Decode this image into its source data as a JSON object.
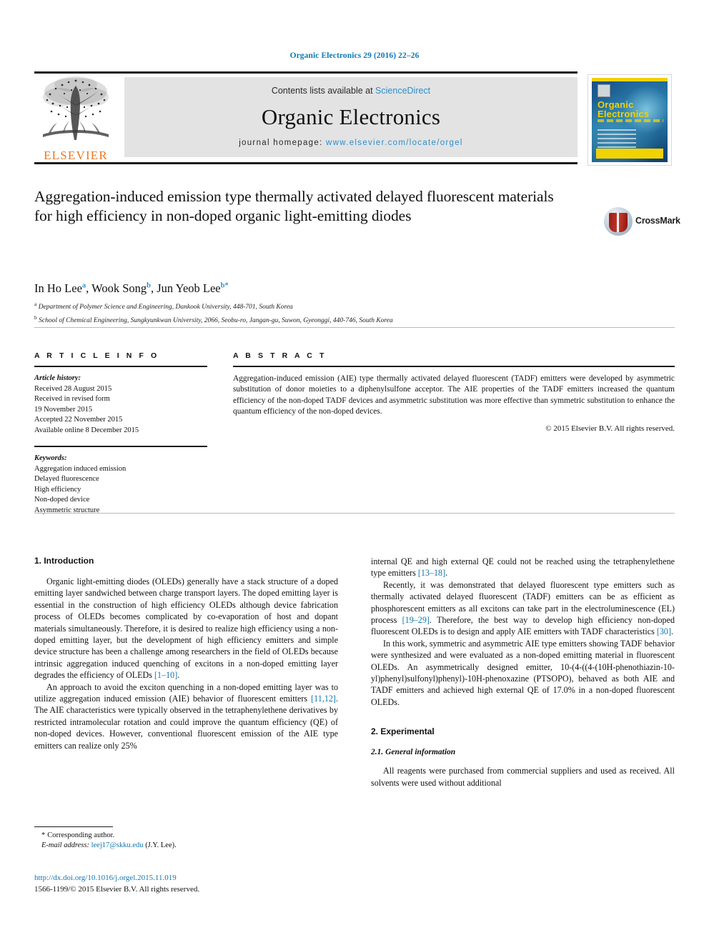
{
  "journal_ref": "Organic Electronics 29 (2016) 22–26",
  "masthead": {
    "contents_prefix": "Contents lists available at ",
    "sciencedirect": "ScienceDirect",
    "journal_name": "Organic Electronics",
    "homepage_prefix": "journal homepage: ",
    "homepage_url": "www.elsevier.com/locate/orgel",
    "publisher_wordmark": "ELSEVIER",
    "publisher_logo_icon": "elsevier-tree-icon",
    "accent_blue": "#2b8fd0",
    "publisher_orange": "#e87722"
  },
  "cover": {
    "line1": "Organic",
    "line2": "Electronics",
    "accent_yellow": "#f2d200"
  },
  "crossmark": {
    "label": "CrossMark",
    "logo_icon": "crossmark-logo-icon"
  },
  "article": {
    "title": "Aggregation-induced emission type thermally activated delayed fluorescent materials for high efficiency in non-doped organic light-emitting diodes",
    "authors": [
      {
        "name": "In Ho Lee",
        "sup": "a"
      },
      {
        "name": "Wook Song",
        "sup": "b"
      },
      {
        "name": "Jun Yeob Lee",
        "sup": "b"
      }
    ],
    "authors_line_prefix": "In Ho Lee ",
    "corresponding_star": "*",
    "affiliations": [
      {
        "marker": "a",
        "text": "Department of Polymer Science and Engineering, Dankook University, 448-701, South Korea"
      },
      {
        "marker": "b",
        "text": "School of Chemical Engineering, Sungkyunkwan University, 2066, Seobu-ro, Jangan-gu, Suwon, Gyeonggi, 440-746, South Korea"
      }
    ]
  },
  "article_info": {
    "heading": "A R T I C L E   I N F O",
    "history_label": "Article history:",
    "history": [
      "Received 28 August 2015",
      "Received in revised form",
      "19 November 2015",
      "Accepted 22 November 2015",
      "Available online 8 December 2015"
    ],
    "keywords_label": "Keywords:",
    "keywords": [
      "Aggregation induced emission",
      "Delayed fluorescence",
      "High efficiency",
      "Non-doped device",
      "Asymmetric structure"
    ]
  },
  "abstract": {
    "heading": "A B S T R A C T",
    "text": "Aggregation-induced emission (AIE) type thermally activated delayed fluorescent (TADF) emitters were developed by asymmetric substitution of donor moieties to a diphenylsulfone acceptor. The AIE properties of the TADF emitters increased the quantum efficiency of the non-doped TADF devices and asymmetric substitution was more effective than symmetric substitution to enhance the quantum efficiency of the non-doped devices.",
    "copyright": "© 2015 Elsevier B.V. All rights reserved."
  },
  "body": {
    "left": {
      "section_heading": "1.  Introduction",
      "paragraph_1": "Organic light-emitting diodes (OLEDs) generally have a stack structure of a doped emitting layer sandwiched between charge transport layers. The doped emitting layer is essential in the construction of high efficiency OLEDs although device fabrication process of OLEDs becomes complicated by co-evaporation of host and dopant materials simultaneously. Therefore, it is desired to realize high efficiency using a non-doped emitting layer, but the development of high efficiency emitters and simple device structure has been a challenge among researchers in the field of OLEDs because intrinsic aggregation induced quenching of excitons in a non-doped emitting layer degrades the efficiency of OLEDs ",
      "paragraph_1_cite": "[1–10]",
      "paragraph_1_tail": ".",
      "paragraph_2_a": "An approach to avoid the exciton quenching in a non-doped emitting layer was to utilize aggregation induced emission (AIE) behavior of fluorescent emitters ",
      "paragraph_2_cite": "[11,12]",
      "paragraph_2_b": ". The AIE characteristics were typically observed in the tetraphenylethene derivatives by restricted intramolecular rotation and could improve the quantum efficiency (QE) of non-doped devices. However, conventional fluorescent emission of the AIE type emitters can realize only 25%"
    },
    "right": {
      "paragraph_1_a": "internal QE and high external QE could not be reached using the tetraphenylethene type emitters ",
      "paragraph_1_cite": "[13–18]",
      "paragraph_1_b": ".",
      "paragraph_2_a": "Recently, it was demonstrated that delayed fluorescent type emitters such as thermally activated delayed fluorescent (TADF) emitters can be as efficient as phosphorescent emitters as all excitons can take part in the electroluminescence (EL) process ",
      "paragraph_2_cite_1": "[19–29]",
      "paragraph_2_b": ". Therefore, the best way to develop high efficiency non-doped fluorescent OLEDs is to design and apply AIE emitters with TADF characteristics ",
      "paragraph_2_cite_2": "[30]",
      "paragraph_2_c": ".",
      "paragraph_3": "In this work, symmetric and asymmetric AIE type emitters showing TADF behavior were synthesized and were evaluated as a non-doped emitting material in fluorescent OLEDs. An asymmetrically designed emitter, 10-(4-((4-(10H-phenothiazin-10- yl)phenyl)sulfonyl)phenyl)-10H-phenoxazine (PTSOPO), behaved as both AIE and TADF emitters and achieved high external QE of 17.0% in a non-doped fluorescent OLEDs.",
      "section_heading": "2.  Experimental",
      "subsection_heading": "2.1.  General information",
      "paragraph_4": "All reagents were purchased from commercial suppliers and used as received. All solvents were used without additional"
    }
  },
  "footnote": {
    "star": "*",
    "corresponding": "Corresponding author.",
    "email_label": "E-mail address:",
    "email": "leej17@skku.edu",
    "email_owner": "(J.Y. Lee)."
  },
  "footer": {
    "doi": "http://dx.doi.org/10.1016/j.orgel.2015.11.019",
    "issn_line": "1566-1199/© 2015 Elsevier B.V. All rights reserved."
  }
}
